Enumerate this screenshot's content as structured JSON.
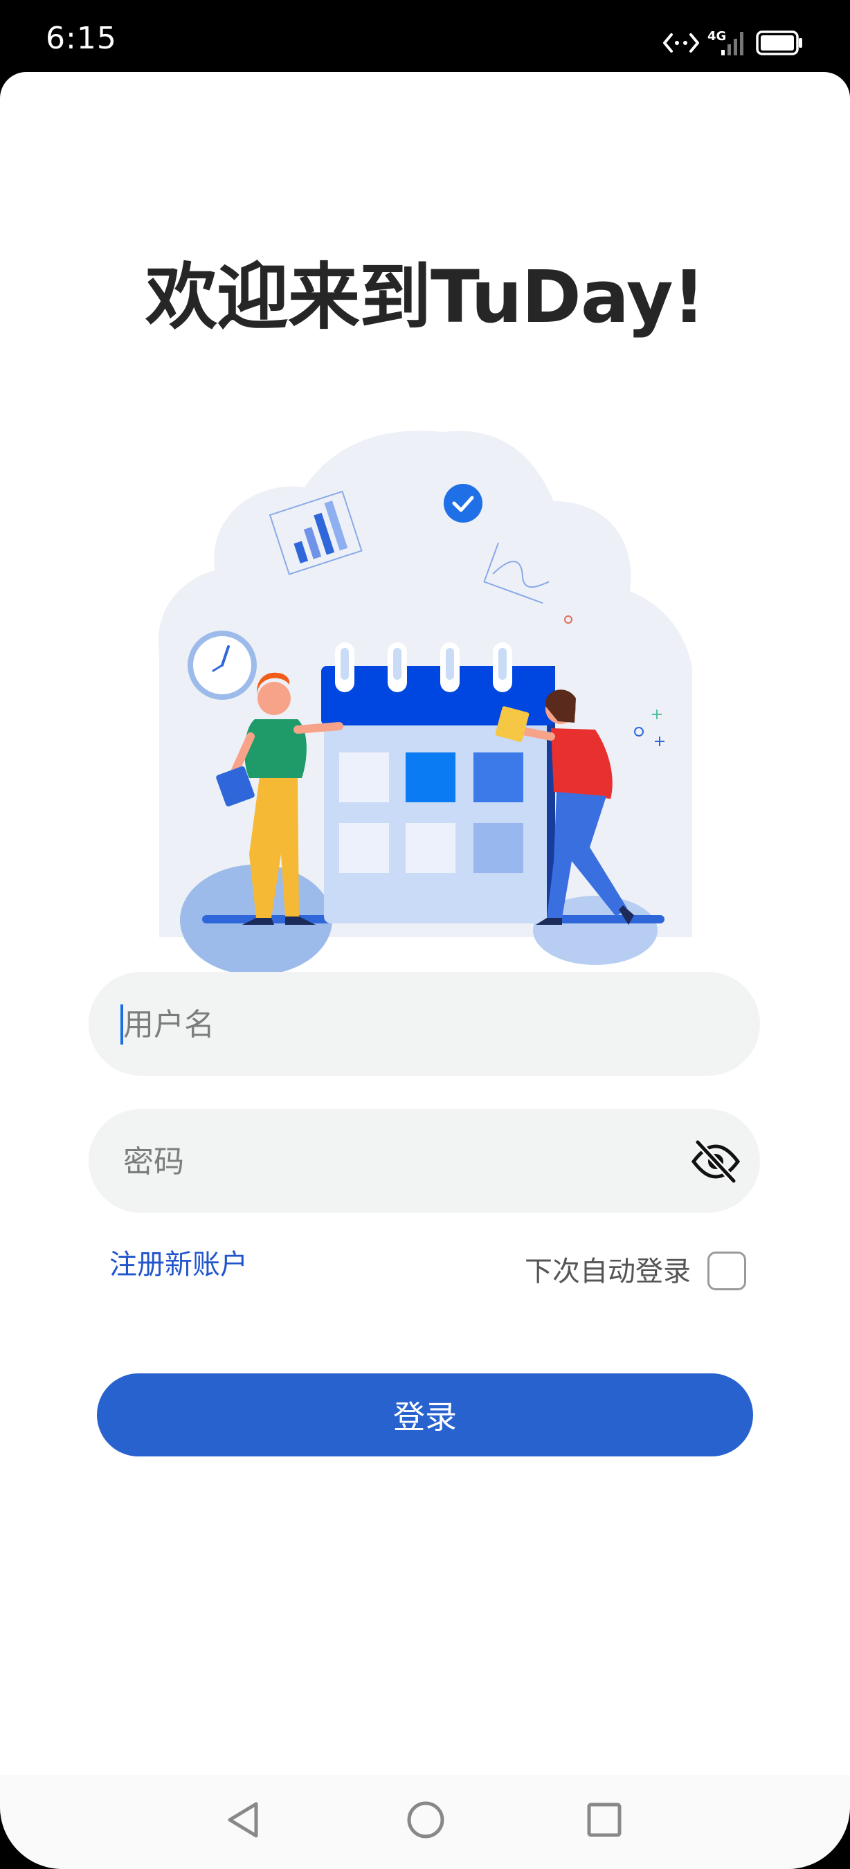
{
  "status_bar": {
    "time": "6:15",
    "network": "4G",
    "icons": [
      "data-transfer-icon",
      "signal-icon",
      "battery-icon"
    ]
  },
  "page": {
    "title": "欢迎来到TuDay!"
  },
  "illustration": {
    "icon": "calendar-scheduling-illustration"
  },
  "form": {
    "username_placeholder": "用户名",
    "password_placeholder": "密码",
    "password_toggle_icon": "eye-slash-icon",
    "register_link": "注册新账户",
    "auto_login_label": "下次自动登录",
    "auto_login_checked": false,
    "login_button": "登录"
  },
  "navigation": {
    "buttons": [
      "back-icon",
      "home-icon",
      "recent-apps-icon"
    ]
  },
  "colors": {
    "accent": "#2762cf",
    "link": "#2255cc",
    "field_bg": "#f2f3f3",
    "title": "#262626"
  }
}
